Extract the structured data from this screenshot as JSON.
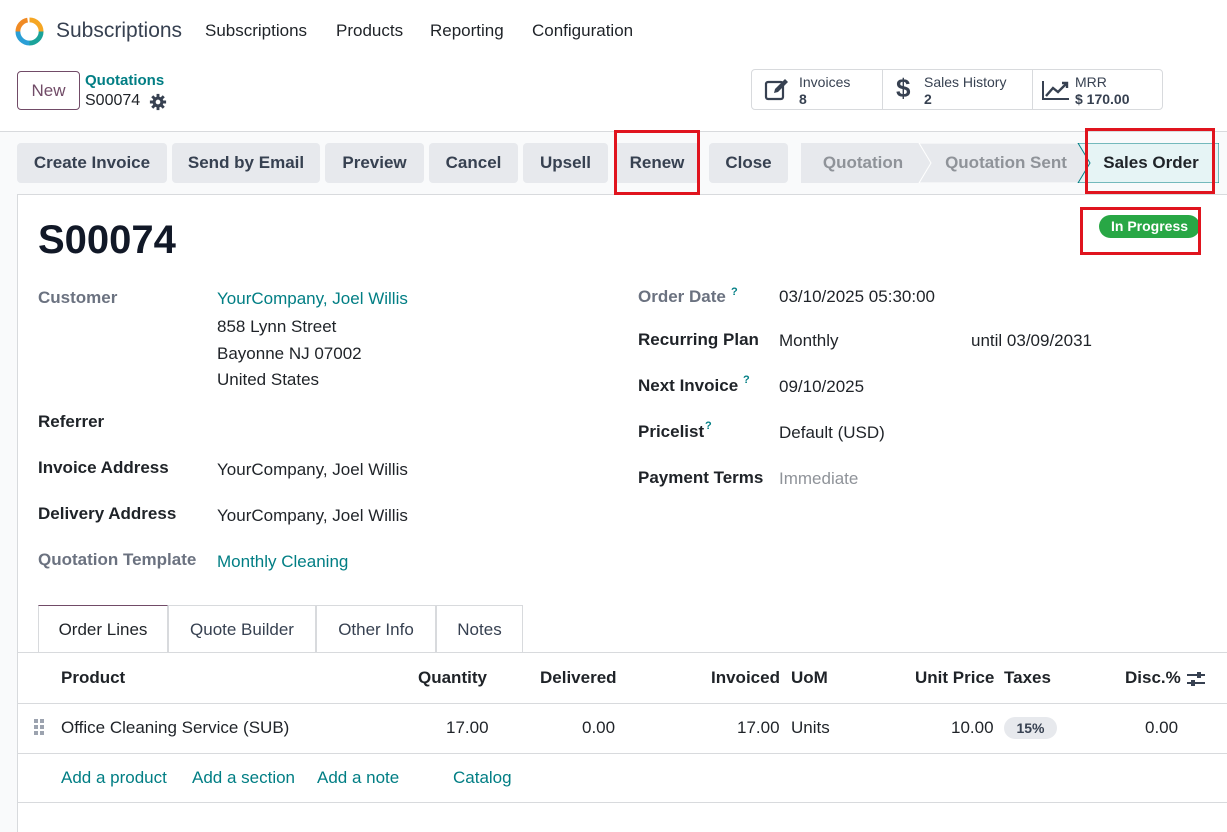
{
  "nav": {
    "app_title": "Subscriptions",
    "items": [
      "Subscriptions",
      "Products",
      "Reporting",
      "Configuration"
    ]
  },
  "control": {
    "new_label": "New",
    "breadcrumb_parent": "Quotations",
    "breadcrumb_current": "S00074"
  },
  "smart_buttons": [
    {
      "icon": "edit-invoice-icon",
      "label": "Invoices",
      "value": "8"
    },
    {
      "icon": "dollar-icon",
      "label": "Sales History",
      "value": "2"
    },
    {
      "icon": "trend-chart-icon",
      "label": "MRR",
      "value": "$ 170.00"
    }
  ],
  "actions": [
    "Create Invoice",
    "Send by Email",
    "Preview",
    "Cancel",
    "Upsell",
    "Renew",
    "Close"
  ],
  "stages": [
    "Quotation",
    "Quotation Sent",
    "Sales Order"
  ],
  "record": {
    "name": "S00074",
    "status": "In Progress"
  },
  "left_fields": {
    "customer_label": "Customer",
    "customer_name": "YourCompany, Joel Willis",
    "customer_street": "858 Lynn Street",
    "customer_city": "Bayonne NJ 07002",
    "customer_country": "United States",
    "referrer_label": "Referrer",
    "invoice_address_label": "Invoice Address",
    "invoice_address": "YourCompany, Joel Willis",
    "delivery_address_label": "Delivery Address",
    "delivery_address": "YourCompany, Joel Willis",
    "quotation_template_label": "Quotation Template",
    "quotation_template": "Monthly Cleaning"
  },
  "right_fields": {
    "order_date_label": "Order Date",
    "order_date": "03/10/2025 05:30:00",
    "recurring_plan_label": "Recurring Plan",
    "recurring_plan": "Monthly",
    "recurring_until": "until 03/09/2031",
    "next_invoice_label": "Next Invoice",
    "next_invoice": "09/10/2025",
    "pricelist_label": "Pricelist",
    "pricelist": "Default (USD)",
    "payment_terms_label": "Payment Terms",
    "payment_terms": "Immediate",
    "help_mark": "?"
  },
  "tabs": [
    "Order Lines",
    "Quote Builder",
    "Other Info",
    "Notes"
  ],
  "table": {
    "headers": [
      "Product",
      "Quantity",
      "Delivered",
      "Invoiced",
      "UoM",
      "Unit Price",
      "Taxes",
      "Disc.%"
    ],
    "rows": [
      {
        "product": "Office Cleaning Service (SUB)",
        "quantity": "17.00",
        "delivered": "0.00",
        "invoiced": "17.00",
        "uom": "Units",
        "unit_price": "10.00",
        "taxes": "15%",
        "disc": "0.00"
      }
    ],
    "add_links": [
      "Add a product",
      "Add a section",
      "Add a note",
      "Catalog"
    ]
  },
  "colors": {
    "brand": "#714b67",
    "link": "#017e84",
    "status_green": "#28a745",
    "highlight_red": "#e0141e"
  }
}
